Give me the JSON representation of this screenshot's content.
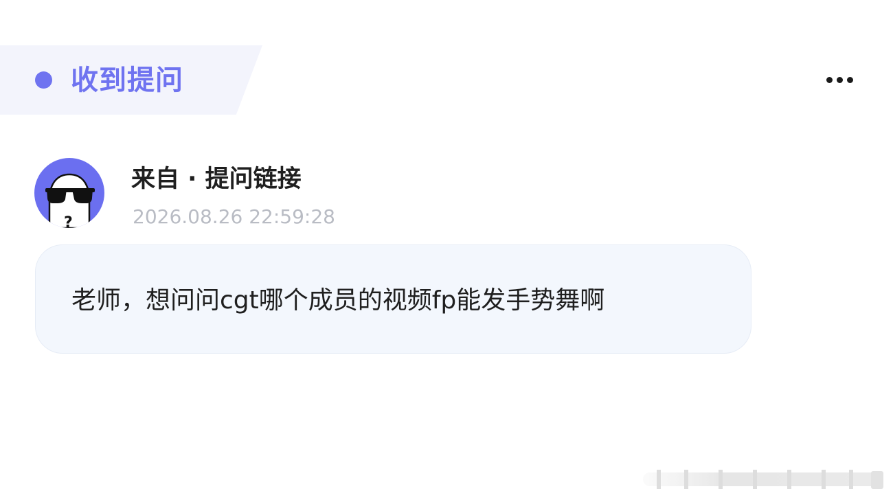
{
  "header": {
    "title": "收到提问",
    "accent_color": "#6f73f0",
    "tag_background": "#f3f4fc"
  },
  "more_menu": {
    "icon": "more-horizontal-icon"
  },
  "sender": {
    "avatar_icon": "anonymous-sunglasses-avatar",
    "avatar_color": "#6b6ff0",
    "label": "来自 · 提问链接",
    "timestamp": "2026.08.26 22:59:28"
  },
  "question": {
    "text": "老师，想问问cgt哪个成员的视频fp能发手势舞啊",
    "background": "#f3f7fd"
  },
  "watermark": {
    "icon": "watermark-logo"
  }
}
